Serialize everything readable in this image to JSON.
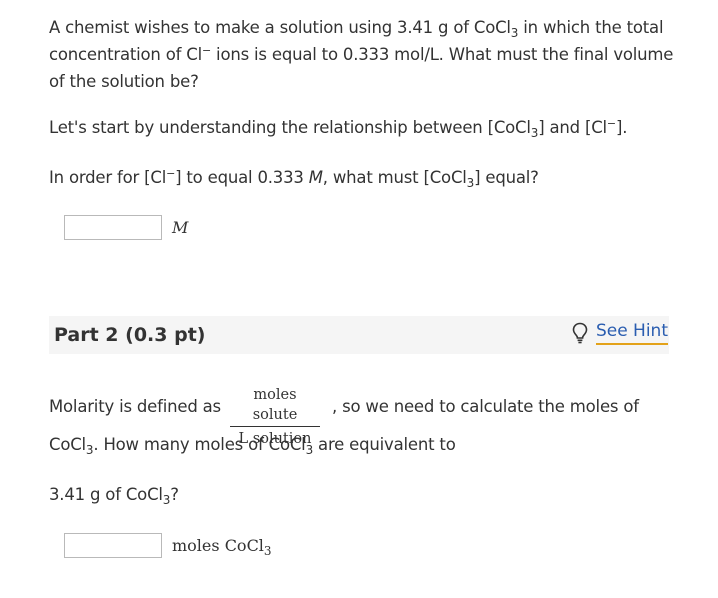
{
  "part1": {
    "problem": {
      "text_a": "A chemist wishes to make a solution using 3.41 g of CoCl",
      "text_a_sub": "3",
      "text_b": " in which the total concentration of Cl",
      "text_b_sup": "−",
      "text_c": " ions is equal to 0.333 mol/L. What must the final volume of the solution be?"
    },
    "intro": {
      "text_a": "Let's start by understanding the relationship between [CoCl",
      "text_a_sub": "3",
      "text_b": "] and [Cl",
      "text_b_sup": "−",
      "text_c": "]."
    },
    "question": {
      "text_a": "In order for [Cl",
      "text_a_sup": "−",
      "text_b": "] to equal 0.333 ",
      "text_b_italic": "M",
      "text_c": ", what must [CoCl",
      "text_c_sub": "3",
      "text_d": "] equal?"
    },
    "answer_unit": "M",
    "answer_value": ""
  },
  "part2": {
    "title": "Part 2 (0.3 pt)",
    "hint_label": "See Hint",
    "hint_icon": "lightbulb-icon",
    "molarity_prefix": "Molarity is defined as",
    "fraction_numerator": "moles solute",
    "fraction_denominator": "L solution",
    "molarity_suffix": ", so we need to calculate the moles of",
    "question_line1": {
      "text_a": "CoCl",
      "text_a_sub": "3",
      "text_b": ". How many moles of CoCl",
      "text_b_sub": "3",
      "text_c": " are equivalent to"
    },
    "question_line2": {
      "text_a": "3.41 g of CoCl",
      "text_a_sub": "3",
      "text_b": "?"
    },
    "answer_unit": "moles CoCl",
    "answer_unit_sub": "3",
    "answer_value": ""
  },
  "colors": {
    "text": "#333333",
    "link": "#2a5db0",
    "hint_underline": "#e3a21a",
    "header_bg": "#f5f5f5"
  }
}
